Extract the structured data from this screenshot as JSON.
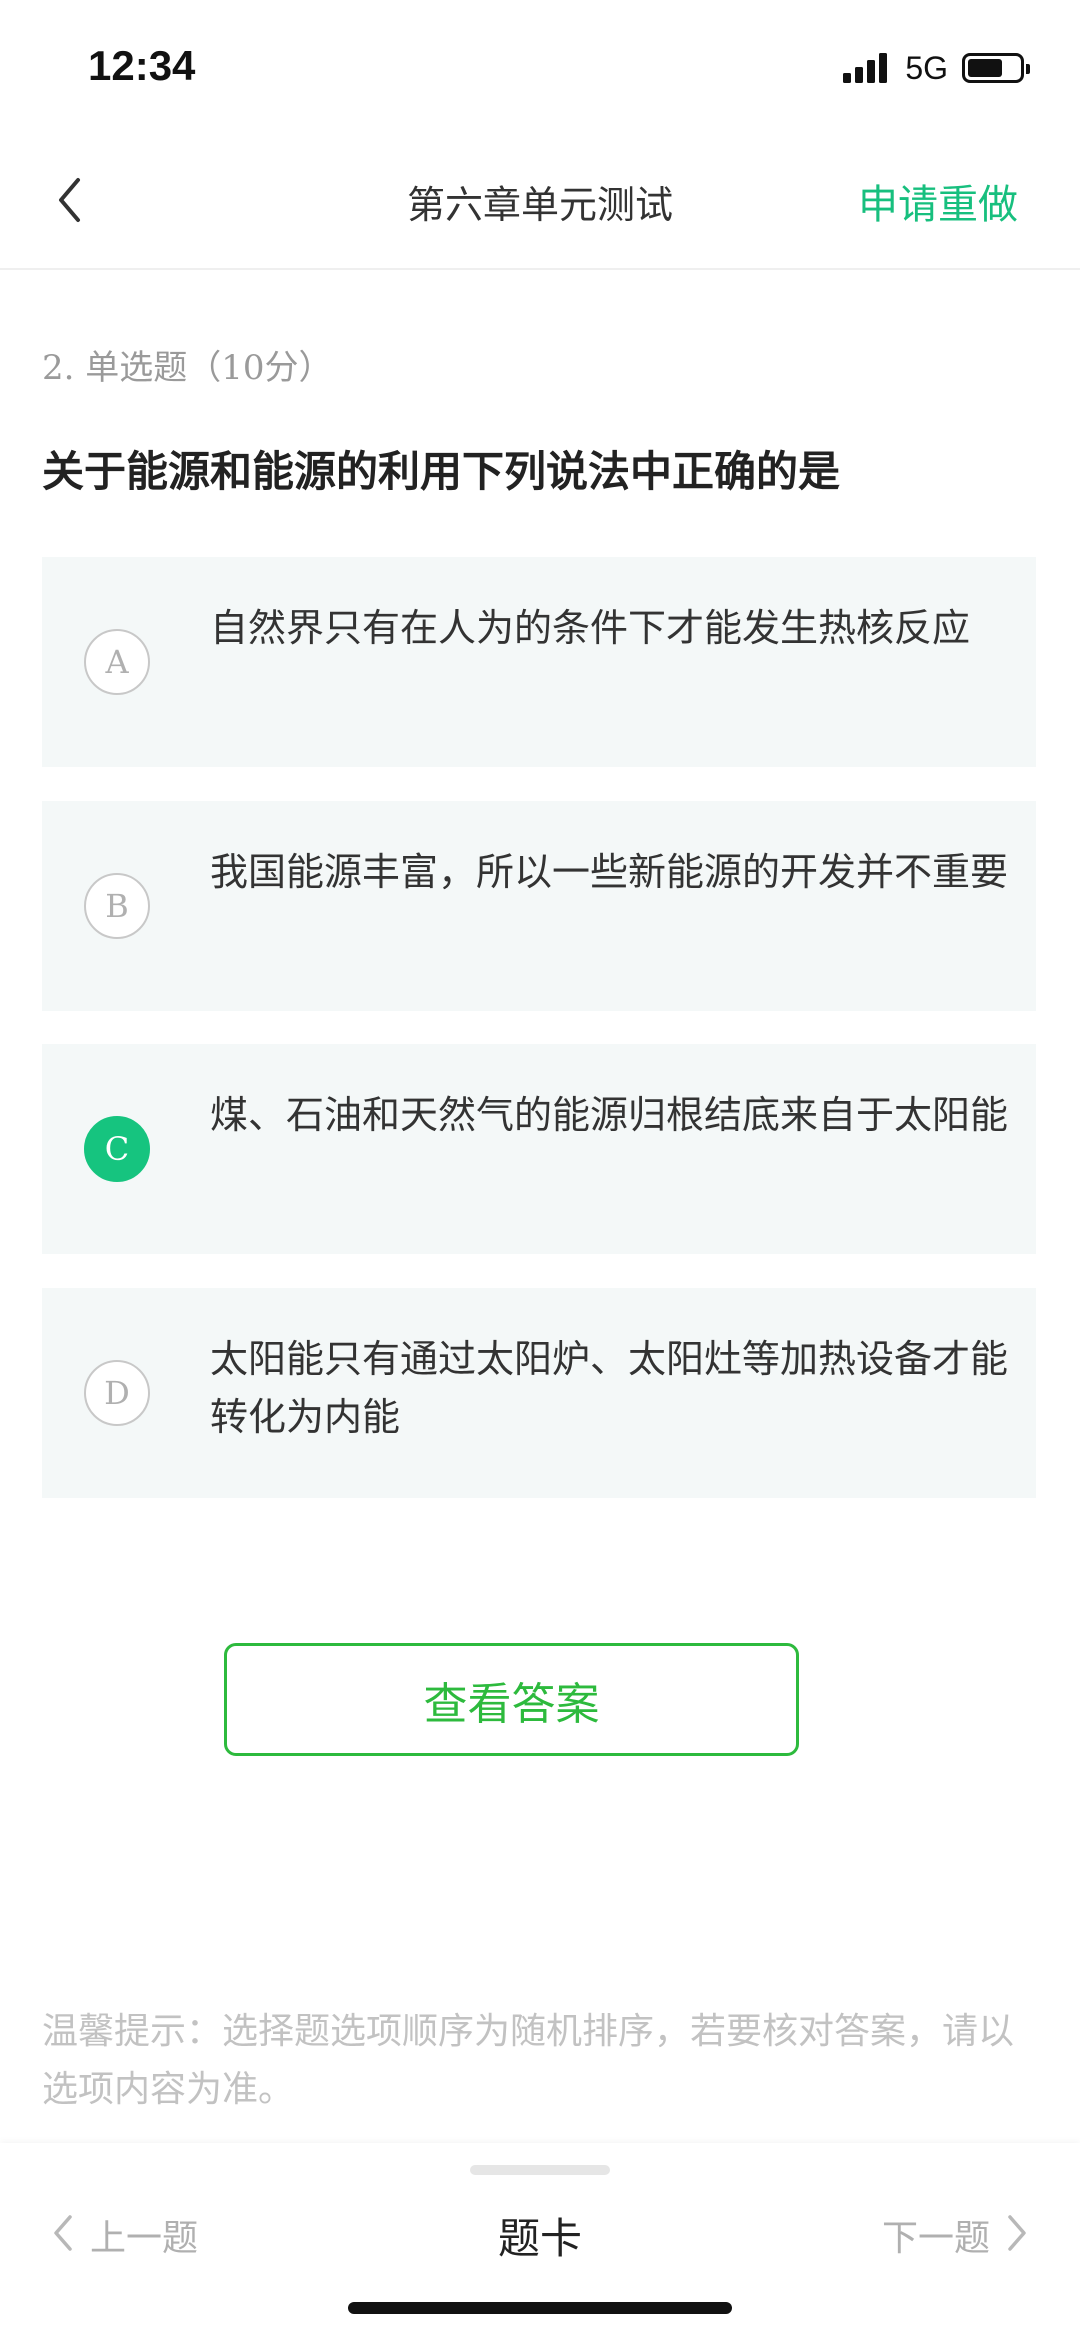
{
  "status_bar": {
    "time": "12:34",
    "network": "5G",
    "icons": [
      "signal-icon",
      "battery-icon"
    ]
  },
  "nav": {
    "back_icon": "chevron-left-icon",
    "title": "第六章单元测试",
    "redo_label": "申请重做"
  },
  "question": {
    "meta": "2. 单选题（10分）",
    "text": "关于能源和能源的利用下列说法中正确的是",
    "options": [
      {
        "letter": "A",
        "text": "自然界只有在人为的条件下才能发生热核反应",
        "selected": false
      },
      {
        "letter": "B",
        "text": "我国能源丰富，所以一些新能源的开发并不重要",
        "selected": false
      },
      {
        "letter": "C",
        "text": "煤、石油和天然气的能源归根结底来自于太阳能",
        "selected": true
      },
      {
        "letter": "D",
        "text": "太阳能只有通过太阳炉、太阳灶等加热设备才能转化为内能",
        "selected": false
      }
    ]
  },
  "view_answer_label": "查看答案",
  "tip": "温馨提示：选择题选项顺序为随机排序，若要核对答案，请以选项内容为准。",
  "bottom_bar": {
    "prev_label": "上一题",
    "card_label": "题卡",
    "next_label": "下一题"
  },
  "colors": {
    "accent": "#17bf7e",
    "selected": "#16c47f",
    "button_border": "#2dba3d",
    "option_bg": "#f4f8f8"
  }
}
